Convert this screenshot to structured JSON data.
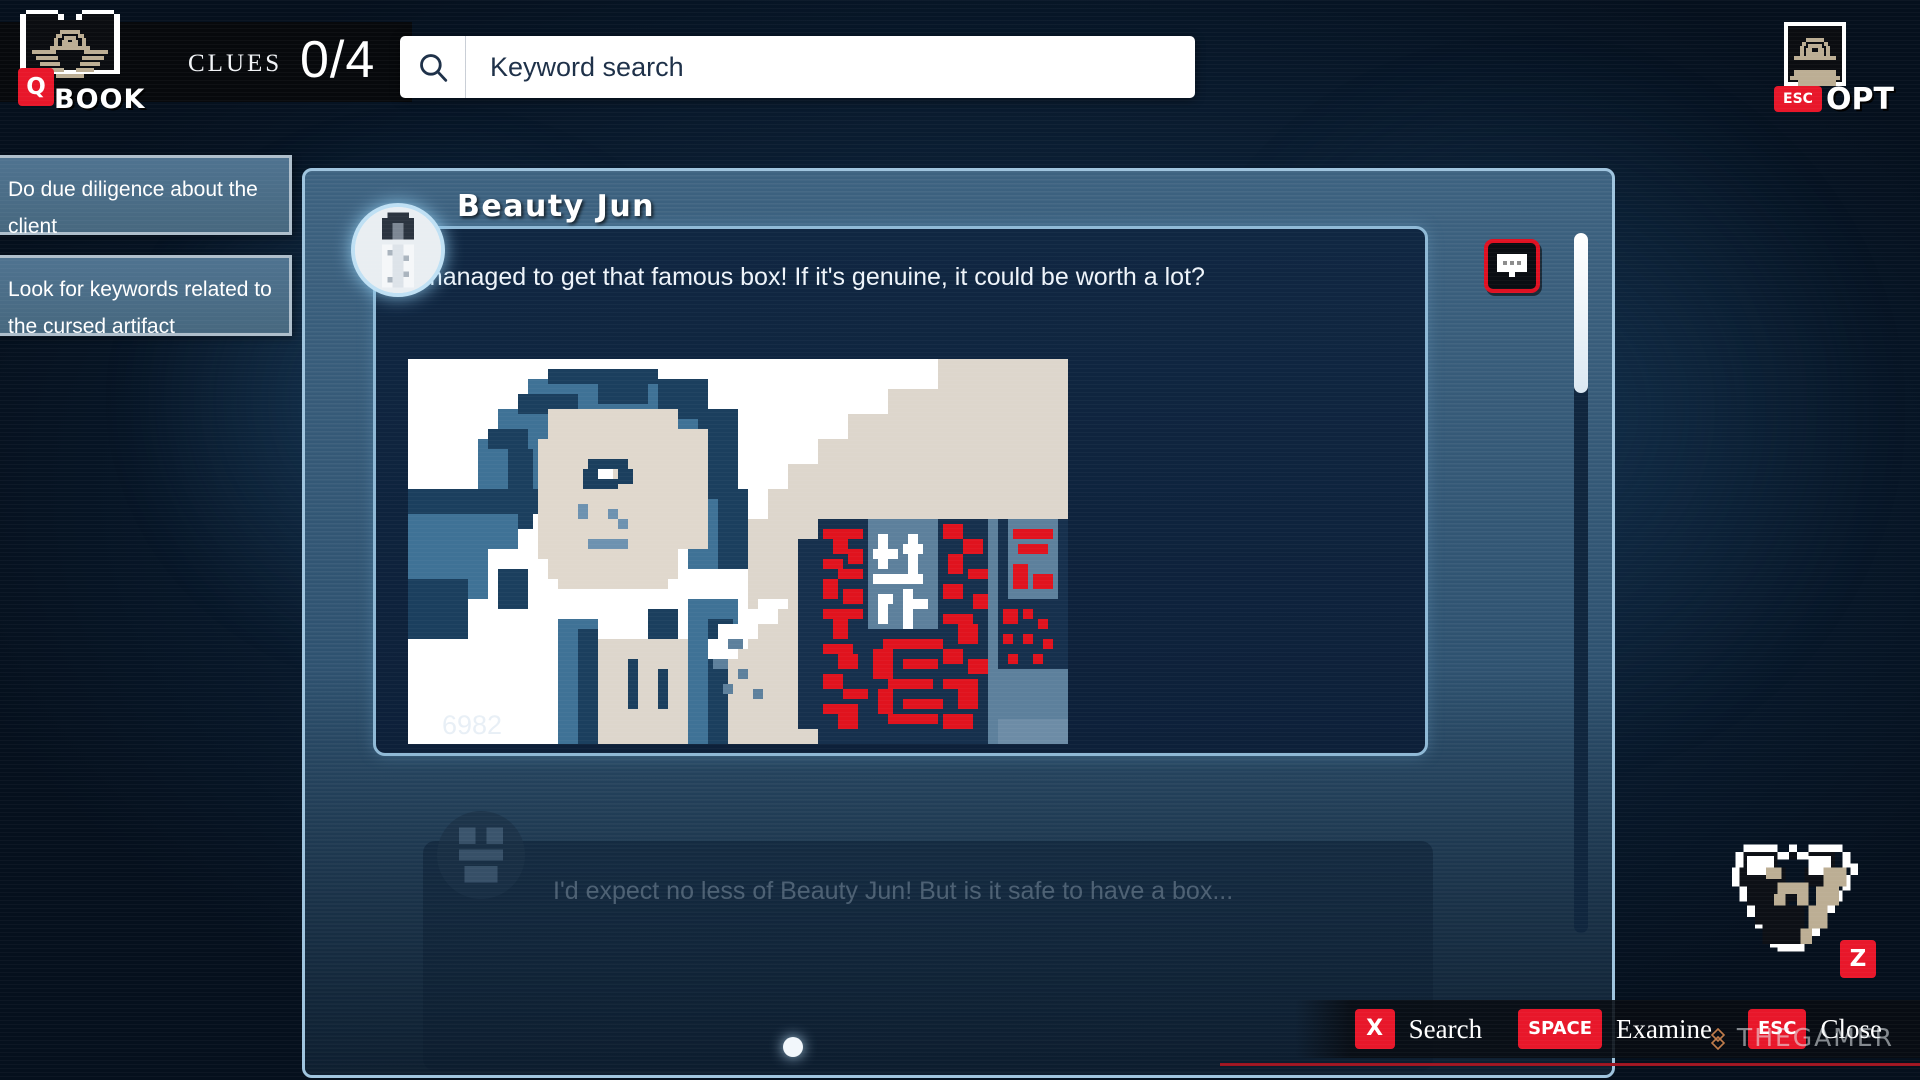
{
  "hud": {
    "book_label": "BOOK",
    "book_key": "Q",
    "book_icon": "open-book-icon",
    "clues_label": "CLUES",
    "clues_count": "0/4",
    "opt_label": "OPT",
    "opt_key": "ESC",
    "opt_icon": "closed-book-icon"
  },
  "search": {
    "placeholder": "Keyword search",
    "value": "",
    "icon": "search-icon"
  },
  "objectives": [
    {
      "text": "Do due diligence about the client"
    },
    {
      "text": "Look for keywords related to the cursed artifact"
    }
  ],
  "dialogue": {
    "speaker": "Beauty Jun",
    "text": "I managed to get that famous box! If it's genuine, it could be worth a lot?",
    "flame_icon": "flame-icon",
    "flame_count": "6982",
    "reply_icon": "chat-bubble-icon",
    "image_alt": "pixel-art of Beauty Jun holding an ornate red cursed box"
  },
  "next_dialogue": {
    "text": "I'd expect no less of Beauty Jun! But is it safe to have a box..."
  },
  "pet": {
    "icon": "dog-face-icon",
    "key": "Z"
  },
  "controls": [
    {
      "key": "X",
      "label": "Search"
    },
    {
      "key": "SPACE",
      "label": "Examine"
    },
    {
      "key": "ESC",
      "label": "Close"
    }
  ],
  "watermark": {
    "text": "THEGAMER"
  },
  "colors": {
    "accent_red": "#e8172a",
    "panel_blue": "#3d6280",
    "bubble_navy": "#102742",
    "card_steel": "#4f7390",
    "border_light": "#9fc4de"
  }
}
